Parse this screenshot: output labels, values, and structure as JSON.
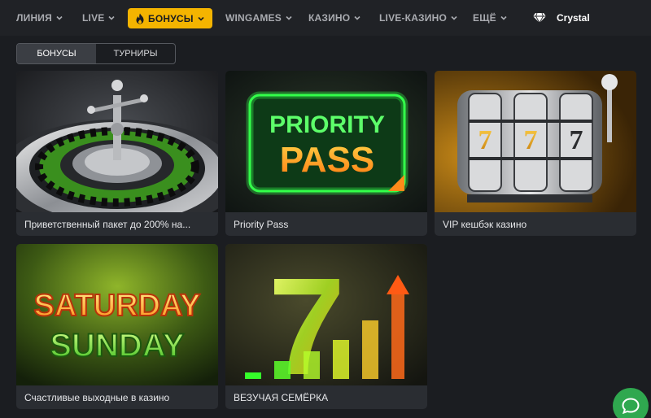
{
  "nav": {
    "items": [
      {
        "label": "ЛИНИЯ",
        "has_dropdown": true
      },
      {
        "label": "LIVE",
        "has_dropdown": true
      },
      {
        "label": "БОНУСЫ",
        "has_dropdown": true,
        "active": true,
        "icon": "flame-icon"
      },
      {
        "label": "WINGAMES",
        "has_dropdown": true
      },
      {
        "label": "КАЗИНО",
        "has_dropdown": true
      },
      {
        "label": "LIVE-КАЗИНО",
        "has_dropdown": true
      },
      {
        "label": "ЕЩЁ",
        "has_dropdown": true
      }
    ],
    "crystal": {
      "label": "Crystal",
      "icon": "diamond-icon"
    },
    "accent_color": "#f4b400"
  },
  "tabs": [
    {
      "label": "БОНУСЫ",
      "active": true
    },
    {
      "label": "ТУРНИРЫ",
      "active": false
    }
  ],
  "cards": [
    {
      "title": "Приветственный пакет до 200% на...",
      "image": "roulette-wheel"
    },
    {
      "title": "Priority Pass",
      "image": "priority-pass-banner",
      "art_text": [
        "PRIORITY",
        "PASS"
      ]
    },
    {
      "title": "VIP кешбэк казино",
      "image": "slot-machine",
      "art_text": [
        "7",
        "7",
        "7"
      ]
    },
    {
      "title": "Счастливые выходные в казино",
      "image": "saturday-sunday-banner",
      "art_text": [
        "SATURDAY",
        "SUNDAY"
      ]
    },
    {
      "title": "ВЕЗУЧАЯ СЕМЁРКА",
      "image": "lucky-seven-growth",
      "art_text": [
        "7"
      ]
    }
  ],
  "chat": {
    "icon": "chat-bubble-icon",
    "color": "#2fa84f"
  }
}
